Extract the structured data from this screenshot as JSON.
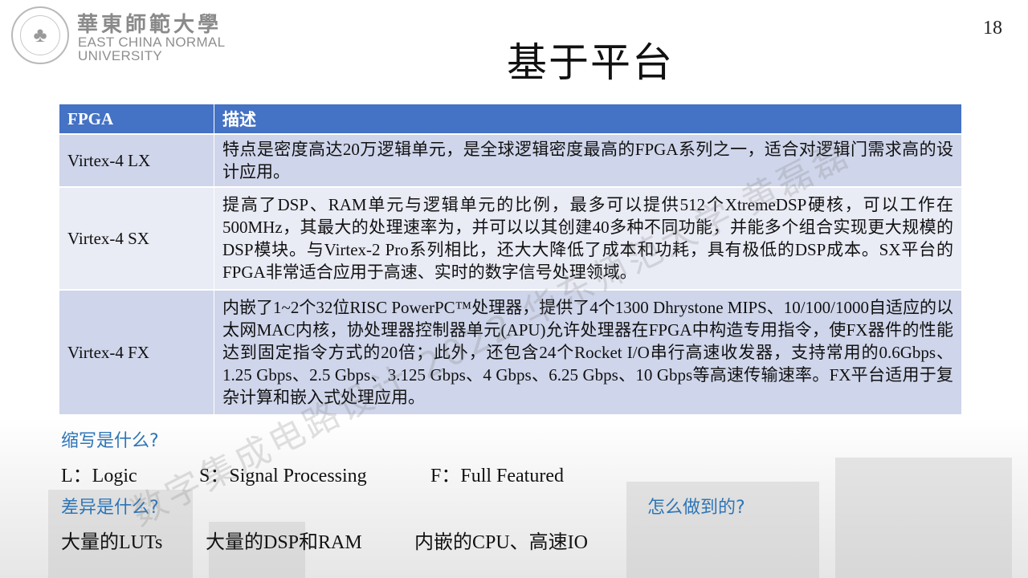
{
  "header": {
    "logo_cn": "華東師範大學",
    "logo_en_line1": "EAST CHINA NORMAL",
    "logo_en_line2": "UNIVERSITY",
    "seal_text": "EAST CHINA NORMAL UNIVERSITY"
  },
  "page_number": "18",
  "title": "基于平台",
  "table": {
    "headers": [
      "FPGA",
      "描述"
    ],
    "rows": [
      {
        "name": "Virtex-4 LX",
        "desc": "特点是密度高达20万逻辑单元，是全球逻辑密度最高的FPGA系列之一，适合对逻辑门需求高的设计应用。"
      },
      {
        "name": "Virtex-4 SX",
        "desc": "提高了DSP、RAM单元与逻辑单元的比例，最多可以提供512个XtremeDSP硬核，可以工作在500MHz，其最大的处理速率为，并可以以其创建40多种不同功能，并能多个组合实现更大规模的DSP模块。与Virtex-2 Pro系列相比，还大大降低了成本和功耗，具有极低的DSP成本。SX平台的FPGA非常适合应用于高速、实时的数字信号处理领域。"
      },
      {
        "name": "Virtex-4 FX",
        "desc": "内嵌了1~2个32位RISC PowerPC™处理器，提供了4个1300 Dhrystone MIPS、10/100/1000自适应的以太网MAC内核，协处理器控制器单元(APU)允许处理器在FPGA中构造专用指令，使FX器件的性能达到固定指令方式的20倍；此外，还包含24个Rocket I/O串行高速收发器，支持常用的0.6Gbps、1.25 Gbps、2.5 Gbps、3.125 Gbps、4 Gbps、6.25 Gbps、10 Gbps等高速传输速率。FX平台适用于复杂计算和嵌入式处理应用。"
      }
    ]
  },
  "questions": {
    "q1": "缩写是什么?",
    "a1_l": "L：Logic",
    "a1_s": "S：Signal Processing",
    "a1_f": "F：Full Featured",
    "q2": "差异是什么?",
    "a2_1": "大量的LUTs",
    "a2_2": "大量的DSP和RAM",
    "a2_3": "内嵌的CPU、高速IO",
    "q3": "怎么做到的?"
  },
  "watermark": "数字集成电路设计 2022 华东师范大学 黄磊磊"
}
